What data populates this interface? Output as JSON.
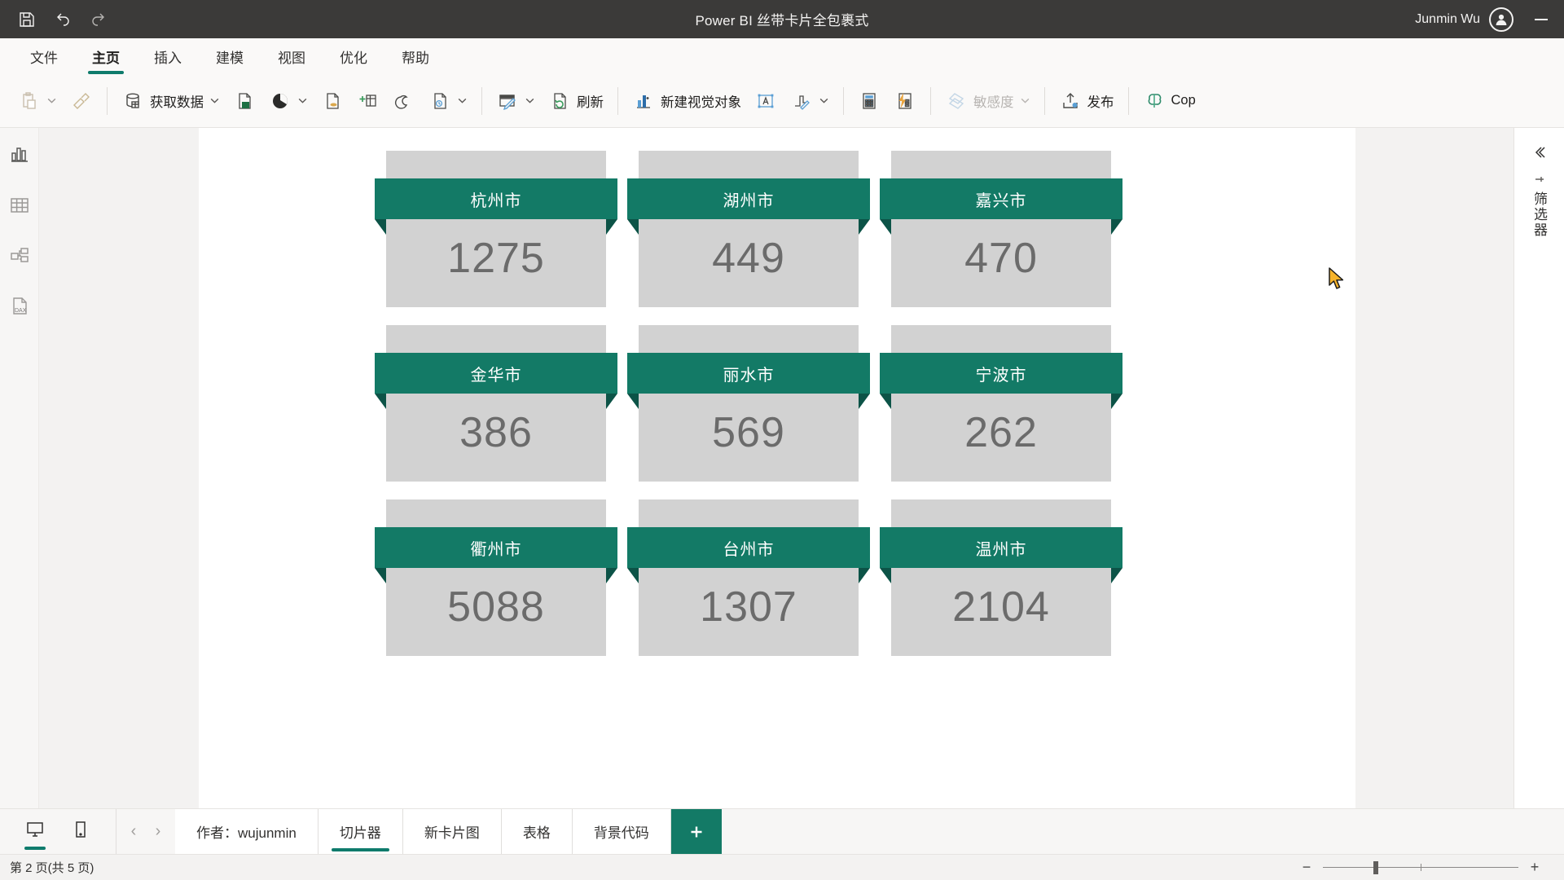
{
  "titlebar": {
    "app_title": "Power BI 丝带卡片全包裹式",
    "user_name": "Junmin Wu",
    "qat": [
      {
        "name": "save-icon",
        "label": "保存"
      },
      {
        "name": "undo-icon",
        "label": "撤销"
      },
      {
        "name": "redo-icon",
        "label": "恢复"
      }
    ],
    "minimize_label": "最小化"
  },
  "ribbon_tabs": [
    {
      "label": "文件",
      "active": false
    },
    {
      "label": "主页",
      "active": true
    },
    {
      "label": "插入",
      "active": false
    },
    {
      "label": "建模",
      "active": false
    },
    {
      "label": "视图",
      "active": false
    },
    {
      "label": "优化",
      "active": false
    },
    {
      "label": "帮助",
      "active": false
    }
  ],
  "toolbar": {
    "paste_label": "",
    "format_painter_label": "",
    "get_data_label": "获取数据",
    "refresh_label": "刷新",
    "new_visual_label": "新建视觉对象",
    "sensitivity_label": "敏感度",
    "publish_label": "发布",
    "copilot_label": "Cop"
  },
  "left_rail": [
    {
      "name": "report-view-icon",
      "label": "报表视图"
    },
    {
      "name": "table-view-icon",
      "label": "表视图"
    },
    {
      "name": "model-view-icon",
      "label": "模型视图"
    },
    {
      "name": "dax-query-view-icon",
      "label": "DAX 查询视图"
    }
  ],
  "right_rail": {
    "expand_label": "展开",
    "panel_title": "筛选器"
  },
  "canvas": {
    "cards": [
      {
        "title": "杭州市",
        "value": "1275"
      },
      {
        "title": "湖州市",
        "value": "449"
      },
      {
        "title": "嘉兴市",
        "value": "470"
      },
      {
        "title": "金华市",
        "value": "386"
      },
      {
        "title": "丽水市",
        "value": "569"
      },
      {
        "title": "宁波市",
        "value": "262"
      },
      {
        "title": "衢州市",
        "value": "5088"
      },
      {
        "title": "台州市",
        "value": "1307"
      },
      {
        "title": "温州市",
        "value": "2104"
      }
    ]
  },
  "tabbar": {
    "view_toggles": [
      {
        "name": "desktop-layout-icon",
        "label": "桌面布局",
        "active": true
      },
      {
        "name": "mobile-layout-icon",
        "label": "移动布局",
        "active": false
      }
    ],
    "nav_prev": "‹",
    "nav_next": "›",
    "page_tabs": [
      {
        "label": "作者：wujunmin",
        "active": false
      },
      {
        "label": "切片器",
        "active": true
      },
      {
        "label": "新卡片图",
        "active": false
      },
      {
        "label": "表格",
        "active": false
      },
      {
        "label": "背景代码",
        "active": false
      }
    ],
    "add_page_label": "+"
  },
  "statusbar": {
    "page_status": "第 2 页(共 5 页)",
    "zoom_out_label": "−",
    "zoom_in_label": "+"
  },
  "colors": {
    "ribbon_teal": "#137a66",
    "ribbon_fold": "#0c5347",
    "card_gray": "#d2d2d2",
    "value_gray": "#6b6b6b",
    "accent": "#0f7b6c",
    "titlebar": "#3b3a39"
  }
}
